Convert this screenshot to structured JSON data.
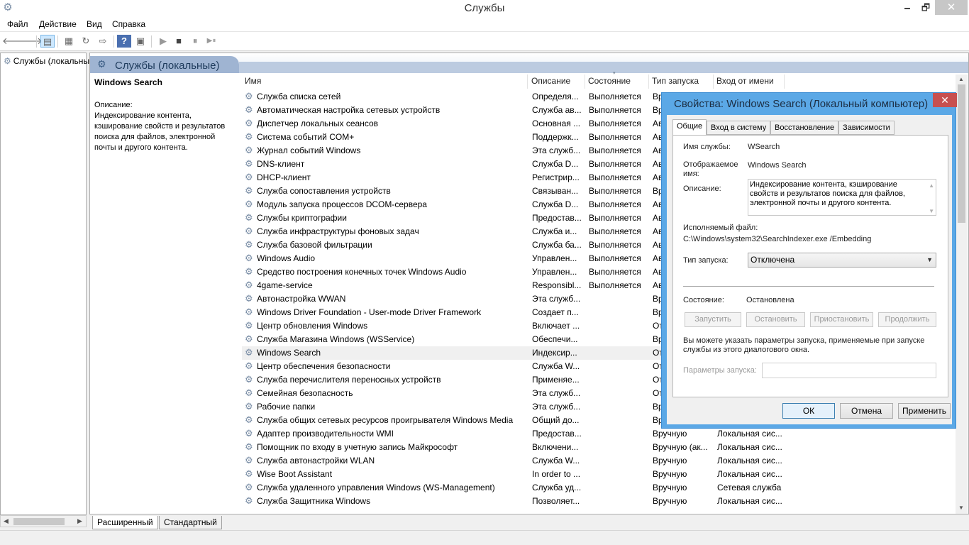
{
  "window": {
    "title": "Службы",
    "minimize": "🗕",
    "maximize": "🗗",
    "close": "✕"
  },
  "menu": [
    "Файл",
    "Действие",
    "Вид",
    "Справка"
  ],
  "toolbar": {
    "back": "🡐",
    "forward": "🡒",
    "show_tree": "▤",
    "properties": "▦",
    "refresh": "↻",
    "export": "⇨",
    "help": "?",
    "console": "▣",
    "play": "▶",
    "stop": "■",
    "pause": "⏸",
    "restart": "▶⏸"
  },
  "tree": {
    "root_label": "Службы (локальные)"
  },
  "panel": {
    "title": "Службы (локальные)"
  },
  "details": {
    "service_name": "Windows Search",
    "description_label": "Описание:",
    "description": "Индексирование контента, кэширование свойств и результатов поиска для файлов, электронной почты и другого контента."
  },
  "columns": {
    "name": "Имя",
    "description": "Описание",
    "state": "Состояние",
    "startup": "Тип запуска",
    "logon": "Вход от имени"
  },
  "services": [
    {
      "name": "Служба списка сетей",
      "description": "Определя...",
      "state": "Выполняется",
      "startup": "Вр",
      "logon": ""
    },
    {
      "name": "Автоматическая настройка сетевых устройств",
      "description": "Служба ав...",
      "state": "Выполняется",
      "startup": "Вр",
      "logon": ""
    },
    {
      "name": "Диспетчер локальных сеансов",
      "description": "Основная ...",
      "state": "Выполняется",
      "startup": "Ав",
      "logon": ""
    },
    {
      "name": "Система событий COM+",
      "description": "Поддержк...",
      "state": "Выполняется",
      "startup": "Ав",
      "logon": ""
    },
    {
      "name": "Журнал событий Windows",
      "description": "Эта служб...",
      "state": "Выполняется",
      "startup": "Ав",
      "logon": ""
    },
    {
      "name": "DNS-клиент",
      "description": "Служба D...",
      "state": "Выполняется",
      "startup": "Ав",
      "logon": ""
    },
    {
      "name": "DHCP-клиент",
      "description": "Регистрир...",
      "state": "Выполняется",
      "startup": "Ав",
      "logon": ""
    },
    {
      "name": "Служба сопоставления устройств",
      "description": "Связыван...",
      "state": "Выполняется",
      "startup": "Вр",
      "logon": ""
    },
    {
      "name": "Модуль запуска процессов DCOM-сервера",
      "description": "Служба D...",
      "state": "Выполняется",
      "startup": "Ав",
      "logon": ""
    },
    {
      "name": "Службы криптографии",
      "description": "Предостав...",
      "state": "Выполняется",
      "startup": "Ав",
      "logon": ""
    },
    {
      "name": "Служба инфраструктуры фоновых задач",
      "description": "Служба и...",
      "state": "Выполняется",
      "startup": "Ав",
      "logon": ""
    },
    {
      "name": "Служба базовой фильтрации",
      "description": "Служба ба...",
      "state": "Выполняется",
      "startup": "Ав",
      "logon": ""
    },
    {
      "name": "Windows Audio",
      "description": "Управлен...",
      "state": "Выполняется",
      "startup": "Ав",
      "logon": ""
    },
    {
      "name": "Средство построения конечных точек Windows Audio",
      "description": "Управлен...",
      "state": "Выполняется",
      "startup": "Ав",
      "logon": ""
    },
    {
      "name": "4game-service",
      "description": "Responsibl...",
      "state": "Выполняется",
      "startup": "Ав",
      "logon": ""
    },
    {
      "name": "Автонастройка WWAN",
      "description": "Эта служб...",
      "state": "",
      "startup": "Вр",
      "logon": ""
    },
    {
      "name": "Windows Driver Foundation - User-mode Driver Framework",
      "description": "Создает п...",
      "state": "",
      "startup": "Вр",
      "logon": ""
    },
    {
      "name": "Центр обновления Windows",
      "description": "Включает ...",
      "state": "",
      "startup": "От",
      "logon": ""
    },
    {
      "name": "Служба Магазина Windows (WSService)",
      "description": "Обеспечи...",
      "state": "",
      "startup": "Вр",
      "logon": ""
    },
    {
      "name": "Windows Search",
      "description": "Индексир...",
      "state": "",
      "startup": "От",
      "logon": "",
      "selected": true
    },
    {
      "name": "Центр обеспечения безопасности",
      "description": "Служба W...",
      "state": "",
      "startup": "От",
      "logon": ""
    },
    {
      "name": "Служба перечислителя переносных устройств",
      "description": "Применяе...",
      "state": "",
      "startup": "От",
      "logon": ""
    },
    {
      "name": "Семейная безопасность",
      "description": "Эта служб...",
      "state": "",
      "startup": "От",
      "logon": ""
    },
    {
      "name": "Рабочие папки",
      "description": "Эта служб...",
      "state": "",
      "startup": "Вр",
      "logon": ""
    },
    {
      "name": "Служба общих сетевых ресурсов проигрывателя Windows Media",
      "description": "Общий до...",
      "state": "",
      "startup": "Вр",
      "logon": ""
    },
    {
      "name": "Адаптер производительности WMI",
      "description": "Предостав...",
      "state": "",
      "startup": "Вручную",
      "logon": "Локальная сис..."
    },
    {
      "name": "Помощник по входу в учетную запись Майкрософт",
      "description": "Включени...",
      "state": "",
      "startup": "Вручную (ак...",
      "logon": "Локальная сис..."
    },
    {
      "name": "Служба автонастройки WLAN",
      "description": "Служба W...",
      "state": "",
      "startup": "Вручную",
      "logon": "Локальная сис..."
    },
    {
      "name": "Wise Boot Assistant",
      "description": "In order to ...",
      "state": "",
      "startup": "Вручную",
      "logon": "Локальная сис..."
    },
    {
      "name": "Служба удаленного управления Windows (WS-Management)",
      "description": "Служба уд...",
      "state": "",
      "startup": "Вручную",
      "logon": "Сетевая служба"
    },
    {
      "name": "Служба Защитника Windows",
      "description": "Позволяет...",
      "state": "",
      "startup": "Вручную",
      "logon": "Локальная сис..."
    }
  ],
  "bottom_tabs": [
    "Расширенный",
    "Стандартный"
  ],
  "dialog": {
    "title": "Свойства: Windows Search (Локальный компьютер)",
    "tabs": [
      "Общие",
      "Вход в систему",
      "Восстановление",
      "Зависимости"
    ],
    "service_name_label": "Имя службы:",
    "service_name": "WSearch",
    "display_name_label": "Отображаемое имя:",
    "display_name": "Windows Search",
    "description_label": "Описание:",
    "description": "Индексирование контента, кэширование свойств и результатов поиска для файлов, электронной почты и другого контента.",
    "exe_label": "Исполняемый файл:",
    "exe_path": "C:\\Windows\\system32\\SearchIndexer.exe /Embedding",
    "startup_label": "Тип запуска:",
    "startup_value": "Отключена",
    "state_label": "Состояние:",
    "state_value": "Остановлена",
    "btn_start": "Запустить",
    "btn_stop": "Остановить",
    "btn_pause": "Приостановить",
    "btn_resume": "Продолжить",
    "hint": "Вы можете указать параметры запуска, применяемые при запуске службы из этого диалогового окна.",
    "params_label": "Параметры запуска:",
    "params_value": "",
    "btn_ok": "ОК",
    "btn_cancel": "Отмена",
    "btn_apply": "Применить"
  }
}
